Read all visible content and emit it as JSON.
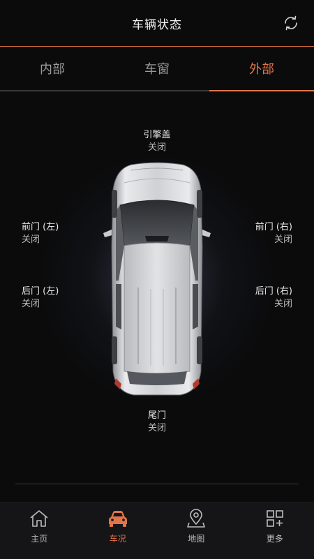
{
  "header": {
    "title": "车辆状态",
    "refresh_icon": "refresh-icon"
  },
  "tabs": [
    {
      "label": "内部",
      "active": false
    },
    {
      "label": "车窗",
      "active": false
    },
    {
      "label": "外部",
      "active": true
    }
  ],
  "status": {
    "hood": {
      "name": "引擎盖",
      "state": "关闭"
    },
    "front_left": {
      "name": "前门 (左)",
      "state": "关闭"
    },
    "front_right": {
      "name": "前门 (右)",
      "state": "关闭"
    },
    "rear_left": {
      "name": "后门 (左)",
      "state": "关闭"
    },
    "rear_right": {
      "name": "后门 (右)",
      "state": "关闭"
    },
    "trunk": {
      "name": "尾门",
      "state": "关闭"
    }
  },
  "bottom_nav": [
    {
      "label": "主页",
      "icon": "home-icon",
      "active": false
    },
    {
      "label": "车况",
      "icon": "car-icon",
      "active": true
    },
    {
      "label": "地图",
      "icon": "map-pin-icon",
      "active": false
    },
    {
      "label": "更多",
      "icon": "grid-plus-icon",
      "active": false
    }
  ],
  "colors": {
    "accent": "#e0744a",
    "background": "#0b0b0c"
  }
}
